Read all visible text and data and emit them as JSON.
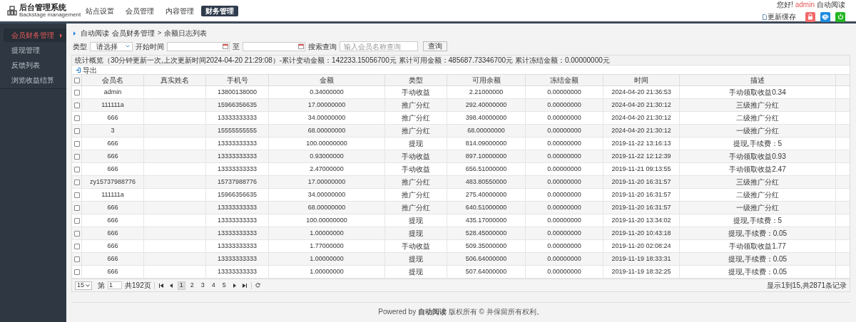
{
  "header": {
    "logo_title": "后台管理系统",
    "logo_subtitle": "Backstage management",
    "nav": [
      {
        "label": "站点设置",
        "selected": false
      },
      {
        "label": "会员管理",
        "selected": false
      },
      {
        "label": "内容管理",
        "selected": false
      },
      {
        "label": "财务管理",
        "selected": true
      }
    ],
    "greeting": "您好!",
    "username": "admin",
    "site_name": "自动阅读",
    "refresh_cache": "更新缓存"
  },
  "sidebar": {
    "items": [
      {
        "label": "会员财务管理",
        "selected": true
      },
      {
        "label": "提现管理",
        "selected": false
      },
      {
        "label": "反馈列表",
        "selected": false
      },
      {
        "label": "浏览收益结算",
        "selected": false
      }
    ]
  },
  "breadcrumb": [
    "自动阅读",
    "会员财务管理",
    "余额日志列表"
  ],
  "breadcrumb_separator": ">",
  "filters": {
    "type_label": "类型",
    "type_value": "请选择",
    "start_label": "开始时间",
    "to_label": "至",
    "search_label": "搜索查询",
    "search_placeholder": "输入会员名称查询",
    "query_button": "查询"
  },
  "stats": "统计概览（30分钟更新一次,上次更新时间2024-04-20 21:29:08）-累计变动金额：142233.15056700元  累计可用金额：485687.73346700元  累计冻结金额：0.00000000元",
  "export_label": "导出",
  "table": {
    "select_all_checked": false,
    "columns": [
      "会员名",
      "真实姓名",
      "手机号",
      "金额",
      "类型",
      "可用余额",
      "冻结金额",
      "时间",
      "描述"
    ],
    "rows": [
      {
        "checked": false,
        "cells": [
          "admin",
          "",
          "13800138000",
          "0.34000000",
          "手动收益",
          "2.21000000",
          "0.00000000",
          "2024-04-20 21:36:53",
          "手动领取收益0.34"
        ]
      },
      {
        "checked": false,
        "cells": [
          "111111a",
          "",
          "15966356635",
          "17.00000000",
          "推广分红",
          "292.40000000",
          "0.00000000",
          "2024-04-20 21:30:12",
          "三级推广分红"
        ]
      },
      {
        "checked": false,
        "cells": [
          "666",
          "",
          "13333333333",
          "34.00000000",
          "推广分红",
          "398.40000000",
          "0.00000000",
          "2024-04-20 21:30:12",
          "二级推广分红"
        ]
      },
      {
        "checked": false,
        "cells": [
          "3",
          "",
          "15555555555",
          "68.00000000",
          "推广分红",
          "68.00000000",
          "0.00000000",
          "2024-04-20 21:30:12",
          "一级推广分红"
        ]
      },
      {
        "checked": false,
        "cells": [
          "666",
          "",
          "13333333333",
          "100.00000000",
          "提现",
          "814.09000000",
          "0.00000000",
          "2019-11-22 13:16:13",
          "提现,手续费：5"
        ]
      },
      {
        "checked": false,
        "cells": [
          "666",
          "",
          "13333333333",
          "0.93000000",
          "手动收益",
          "897.10000000",
          "0.00000000",
          "2019-11-22 12:12:39",
          "手动领取收益0.93"
        ]
      },
      {
        "checked": false,
        "cells": [
          "666",
          "",
          "13333333333",
          "2.47000000",
          "手动收益",
          "656.51000000",
          "0.00000000",
          "2019-11-21 09:13:55",
          "手动领取收益2.47"
        ]
      },
      {
        "checked": false,
        "cells": [
          "zy15737988776",
          "",
          "15737988776",
          "17.00000000",
          "推广分红",
          "483.80550000",
          "0.00000000",
          "2019-11-20 16:31:57",
          "三级推广分红"
        ]
      },
      {
        "checked": false,
        "cells": [
          "111111a",
          "",
          "15966356635",
          "34.00000000",
          "推广分红",
          "275.40000000",
          "0.00000000",
          "2019-11-20 16:31:57",
          "二级推广分红"
        ]
      },
      {
        "checked": false,
        "cells": [
          "666",
          "",
          "13333333333",
          "68.00000000",
          "推广分红",
          "640.51000000",
          "0.00000000",
          "2019-11-20 16:31:57",
          "一级推广分红"
        ]
      },
      {
        "checked": false,
        "cells": [
          "666",
          "",
          "13333333333",
          "100.00000000",
          "提现",
          "435.17000000",
          "0.00000000",
          "2019-11-20 13:34:02",
          "提现,手续费：5"
        ]
      },
      {
        "checked": false,
        "cells": [
          "666",
          "",
          "13333333333",
          "1.00000000",
          "提现",
          "528.45000000",
          "0.00000000",
          "2019-11-20 10:43:18",
          "提现,手续费：0.05"
        ]
      },
      {
        "checked": false,
        "cells": [
          "666",
          "",
          "13333333333",
          "1.77000000",
          "手动收益",
          "509.35000000",
          "0.00000000",
          "2019-11-20 02:08:24",
          "手动领取收益1.77"
        ]
      },
      {
        "checked": false,
        "cells": [
          "666",
          "",
          "13333333333",
          "1.00000000",
          "提现",
          "506.64000000",
          "0.00000000",
          "2019-11-19 18:33:31",
          "提现,手续费：0.05"
        ]
      },
      {
        "checked": false,
        "cells": [
          "666",
          "",
          "13333333333",
          "1.00000000",
          "提现",
          "507.64000000",
          "0.00000000",
          "2019-11-19 18:32:25",
          "提现,手续费：0.05"
        ]
      }
    ]
  },
  "pagination": {
    "page_size": "15",
    "page_prefix": "第",
    "page_value": "1",
    "page_total": "共192页",
    "pages": [
      {
        "label": "1",
        "selected": true
      },
      {
        "label": "2",
        "selected": false
      },
      {
        "label": "3",
        "selected": false
      },
      {
        "label": "4",
        "selected": false
      },
      {
        "label": "5",
        "selected": false
      }
    ],
    "summary": "显示1到15,共2871条记录"
  },
  "footer": "Powered by **自动阅读** 版权所有 © 并保留所有权利。"
}
